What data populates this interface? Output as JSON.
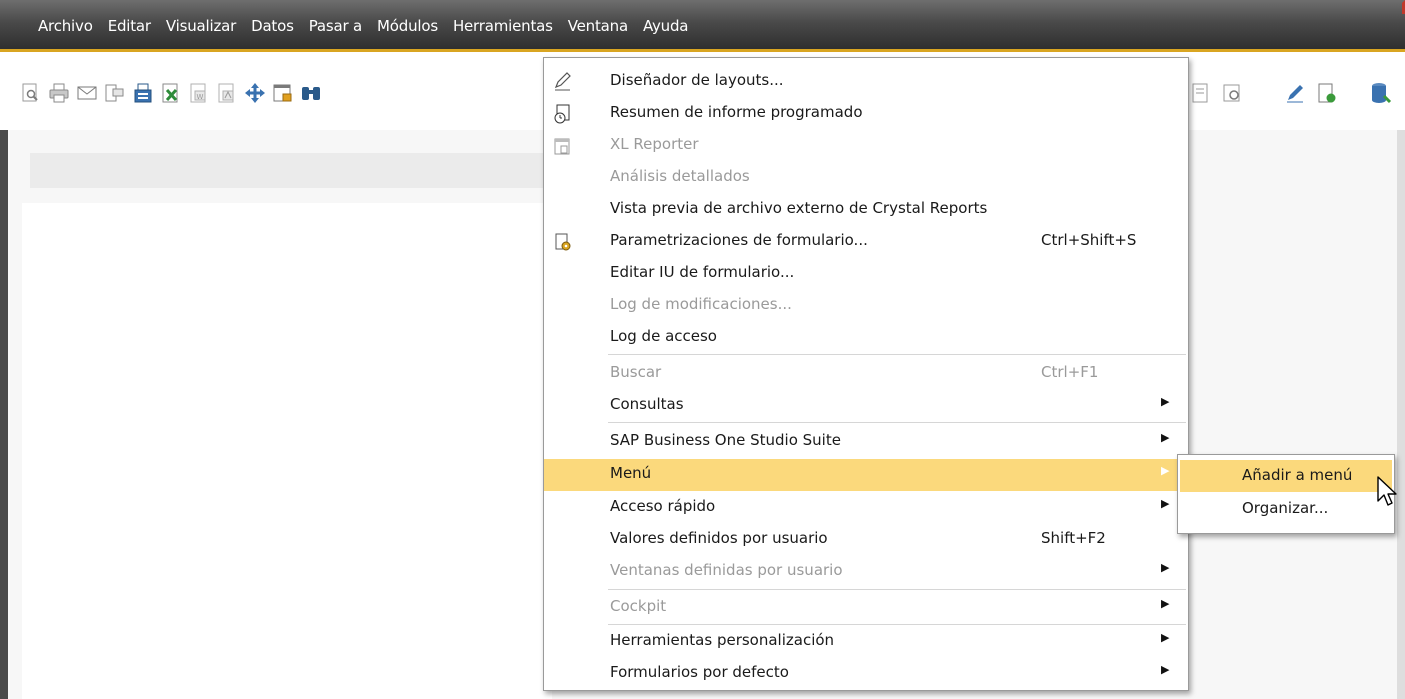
{
  "menubar": {
    "items": [
      "Archivo",
      "Editar",
      "Visualizar",
      "Datos",
      "Pasar a",
      "Módulos",
      "Herramientas",
      "Ventana",
      "Ayuda"
    ],
    "open_item": "Herramientas"
  },
  "colors": {
    "menubar_top": "#6e6e6e",
    "menubar_bottom": "#2f2f2f",
    "accent": "#d9a521",
    "highlight": "#fbd97c"
  },
  "toolbar": {
    "icons": [
      "print-preview-icon",
      "print-icon",
      "email-icon",
      "sms-icon",
      "fax-icon",
      "export-excel-icon",
      "export-word-icon",
      "export-pdf-icon",
      "move-icon",
      "lock-form-icon",
      "find-icon",
      "layout-designer-icon",
      "query-icon",
      "edit-icon",
      "new-doc-icon",
      "database-icon"
    ]
  },
  "menu": {
    "items": [
      {
        "label": "Diseñador de layouts...",
        "shortcut": "",
        "submenu": false,
        "disabled": false,
        "icon": "pencil-icon"
      },
      {
        "label": "Resumen de informe programado",
        "shortcut": "",
        "submenu": false,
        "disabled": false,
        "icon": "scheduled-report-icon"
      },
      {
        "label": "XL Reporter",
        "shortcut": "",
        "submenu": false,
        "disabled": true,
        "icon": "xl-reporter-icon"
      },
      {
        "label": "Análisis detallados",
        "shortcut": "",
        "submenu": false,
        "disabled": true,
        "icon": ""
      },
      {
        "label": "Vista previa de archivo externo de Crystal Reports",
        "shortcut": "",
        "submenu": false,
        "disabled": false,
        "icon": ""
      },
      {
        "label": "Parametrizaciones de formulario...",
        "shortcut": "Ctrl+Shift+S",
        "submenu": false,
        "disabled": false,
        "icon": "form-settings-icon"
      },
      {
        "label": "Editar IU de formulario...",
        "shortcut": "",
        "submenu": false,
        "disabled": false,
        "icon": ""
      },
      {
        "label": "Log de modificaciones...",
        "shortcut": "",
        "submenu": false,
        "disabled": true,
        "icon": ""
      },
      {
        "label": "Log de acceso",
        "shortcut": "",
        "submenu": false,
        "disabled": false,
        "icon": ""
      },
      {
        "label": "Buscar",
        "shortcut": "Ctrl+F1",
        "submenu": false,
        "disabled": true,
        "icon": ""
      },
      {
        "label": "Consultas",
        "shortcut": "",
        "submenu": true,
        "disabled": false,
        "icon": ""
      },
      {
        "label": "SAP Business One Studio Suite",
        "shortcut": "",
        "submenu": true,
        "disabled": false,
        "icon": ""
      },
      {
        "label": "Menú",
        "shortcut": "",
        "submenu": true,
        "disabled": false,
        "icon": ""
      },
      {
        "label": "Acceso rápido",
        "shortcut": "",
        "submenu": true,
        "disabled": false,
        "icon": ""
      },
      {
        "label": "Valores definidos por usuario",
        "shortcut": "Shift+F2",
        "submenu": false,
        "disabled": false,
        "icon": ""
      },
      {
        "label": "Ventanas definidas por usuario",
        "shortcut": "",
        "submenu": true,
        "disabled": true,
        "icon": ""
      },
      {
        "label": "Cockpit",
        "shortcut": "",
        "submenu": true,
        "disabled": true,
        "icon": ""
      },
      {
        "label": "Herramientas personalización",
        "shortcut": "",
        "submenu": true,
        "disabled": false,
        "icon": ""
      },
      {
        "label": "Formularios por defecto",
        "shortcut": "",
        "submenu": true,
        "disabled": false,
        "icon": ""
      }
    ],
    "highlighted": "Menú"
  },
  "submenu": {
    "items": [
      {
        "label": "Añadir a menú"
      },
      {
        "label": "Organizar..."
      }
    ],
    "highlighted": "Añadir a menú"
  }
}
